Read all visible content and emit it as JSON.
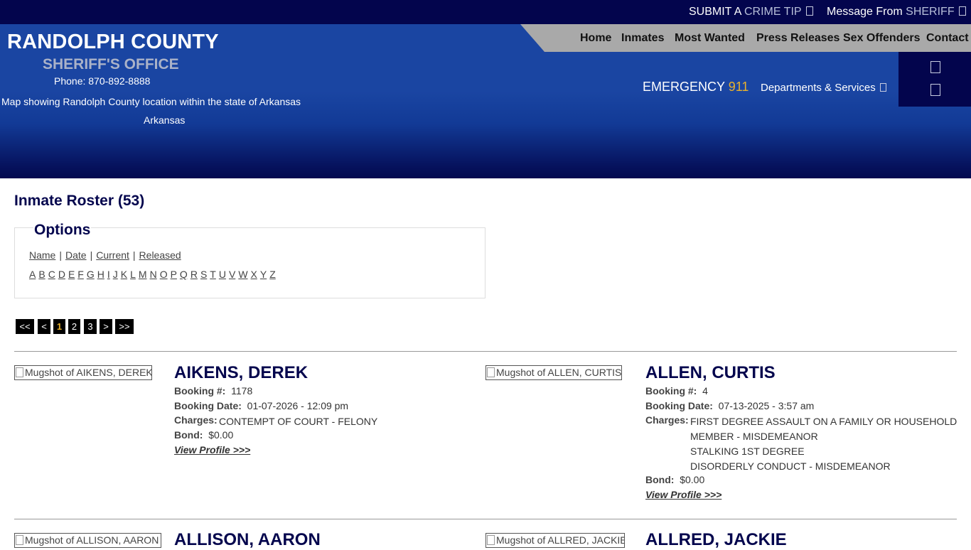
{
  "topbar": {
    "crime_tip_pre": "SUBMIT A",
    "crime_tip_hl": "CRIME TIP",
    "sheriff_pre": "Message From",
    "sheriff_hl": "SHERIFF",
    "ext_icon": "external-link-icon"
  },
  "header": {
    "county": "RANDOLPH COUNTY",
    "office": "SHERIFF'S OFFICE",
    "phone": "Phone: 870-892-8888",
    "map_alt": "Map showing Randolph County location within the state of Arkansas",
    "state": "Arkansas",
    "emergency_label": "EMERGENCY",
    "emergency_number": "911",
    "departments": "Departments & Services",
    "icon_names": [
      "facebook-icon",
      "search-icon"
    ]
  },
  "nav": {
    "items": [
      "Home",
      "Inmates",
      "Most Wanted",
      "Press Releases",
      "Sex Offenders",
      "Contact"
    ]
  },
  "main": {
    "title": "Inmate Roster (53)",
    "options_legend": "Options",
    "sort_links": [
      "Name",
      "Date",
      "Current",
      "Released"
    ],
    "alphabet": [
      "A",
      "B",
      "C",
      "D",
      "E",
      "F",
      "G",
      "H",
      "I",
      "J",
      "K",
      "L",
      "M",
      "N",
      "O",
      "P",
      "Q",
      "R",
      "S",
      "T",
      "U",
      "V",
      "W",
      "X",
      "Y",
      "Z"
    ],
    "pager": [
      "<<",
      "<",
      "1",
      "2",
      "3",
      ">",
      ">>"
    ],
    "pager_active": "1"
  },
  "labels": {
    "booking_no": "Booking #:",
    "booking_date": "Booking Date:",
    "charges": "Charges:",
    "bond": "Bond:",
    "view_profile": "View Profile >>>"
  },
  "inmates": [
    {
      "name": "AIKENS, DEREK",
      "mug_alt": "Mugshot of AIKENS, DEREK",
      "booking_no": "1178",
      "booking_date": "01-07-2026 - 12:09 pm",
      "charges": [
        "CONTEMPT OF COURT - FELONY"
      ],
      "bond": "$0.00"
    },
    {
      "name": "ALLEN, CURTIS",
      "mug_alt": "Mugshot of ALLEN, CURTIS",
      "booking_no": "4",
      "booking_date": "07-13-2025 - 3:57 am",
      "charges": [
        "FIRST DEGREE ASSAULT ON A FAMILY OR HOUSEHOLD",
        "MEMBER - MISDEMEANOR",
        "STALKING 1ST DEGREE",
        "DISORDERLY CONDUCT - MISDEMEANOR"
      ],
      "bond": "$0.00"
    },
    {
      "name": "ALLISON, AARON",
      "mug_alt": "Mugshot of ALLISON, AARON"
    },
    {
      "name": "ALLRED, JACKIE",
      "mug_alt": "Mugshot of ALLRED, JACKIE"
    }
  ]
}
